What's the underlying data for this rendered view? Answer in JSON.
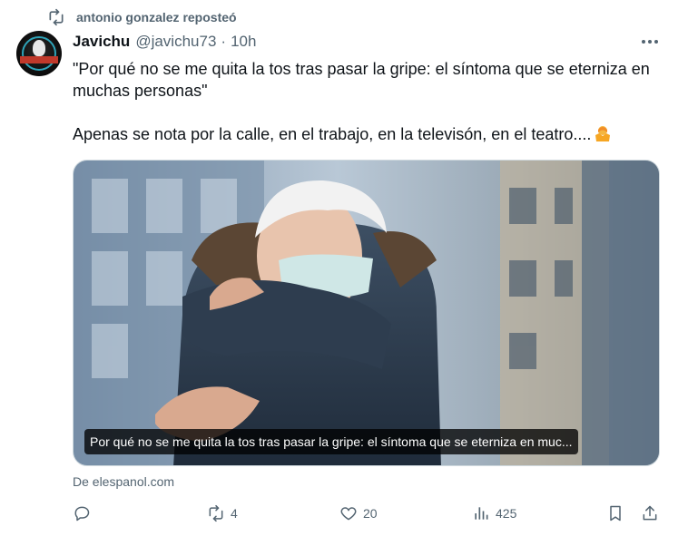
{
  "repost": {
    "text": "antonio gonzalez reposteó",
    "icon": "repost-icon"
  },
  "tweet": {
    "author_name": "Javichu",
    "handle": "@javichu73",
    "separator": "·",
    "time": "10h",
    "line1": "\"Por qué no se me quita la tos tras pasar la gripe: el síntoma que se eterniza en muchas personas\"",
    "line2": "Apenas se nota por la calle, en el trabajo, en la televisón, en el teatro....",
    "emoji": "woman-shrugging-emoji"
  },
  "card": {
    "caption": "Por qué no se me quita la tos tras pasar la gripe: el síntoma que se eterniza en muc...",
    "source": "De elespanol.com"
  },
  "actions": {
    "reply_count": "",
    "repost_count": "4",
    "like_count": "20",
    "views_count": "425"
  },
  "colors": {
    "text": "#0f1419",
    "muted": "#536471",
    "border": "#cfd9de"
  }
}
